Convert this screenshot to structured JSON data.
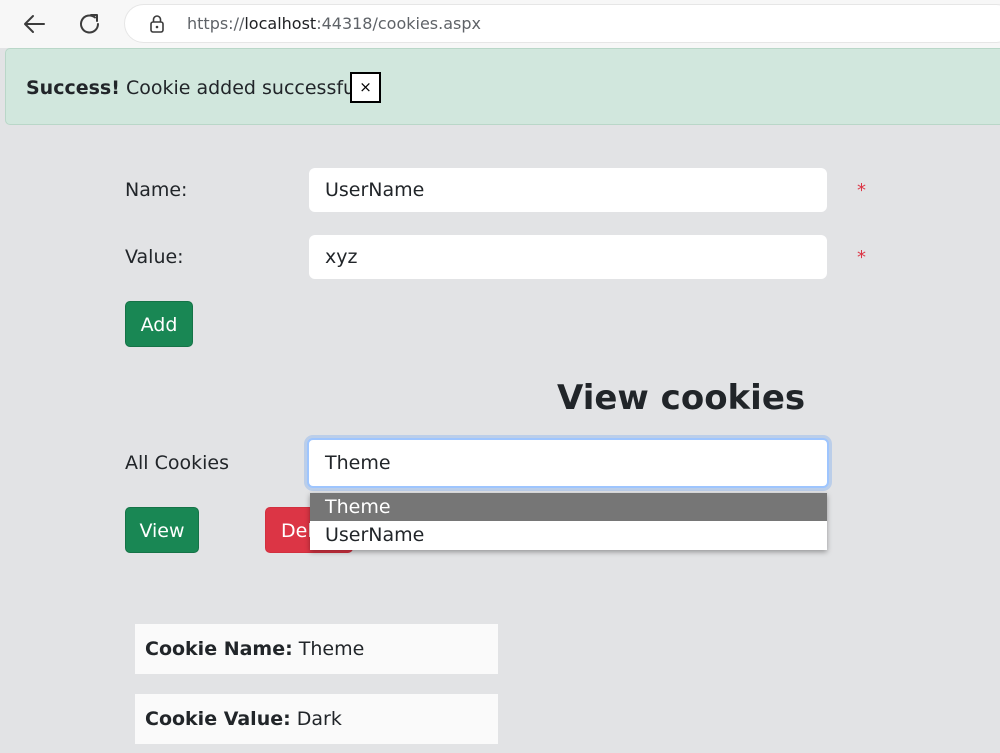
{
  "browser": {
    "url_prefix": "https://",
    "url_host": "localhost",
    "url_rest": ":44318/cookies.aspx"
  },
  "alert": {
    "strong": "Success!",
    "message": "Cookie added successfully.",
    "close_label": "×"
  },
  "form": {
    "name_label": "Name:",
    "name_value": "UserName",
    "value_label": "Value:",
    "value_value": "xyz",
    "required_marker": "*",
    "add_label": "Add"
  },
  "view": {
    "heading": "View cookies",
    "all_cookies_label": "All Cookies",
    "selected": "Theme",
    "options": [
      "Theme",
      "UserName"
    ],
    "view_label": "View",
    "delete_label": "Del"
  },
  "details": {
    "name_key": "Cookie Name:",
    "name_val": "Theme",
    "value_key": "Cookie Value:",
    "value_val": "Dark"
  },
  "colors": {
    "success": "#198754",
    "danger": "#dc3545",
    "alert_bg": "#d1e7dd",
    "page_bg": "#e2e3e5"
  }
}
